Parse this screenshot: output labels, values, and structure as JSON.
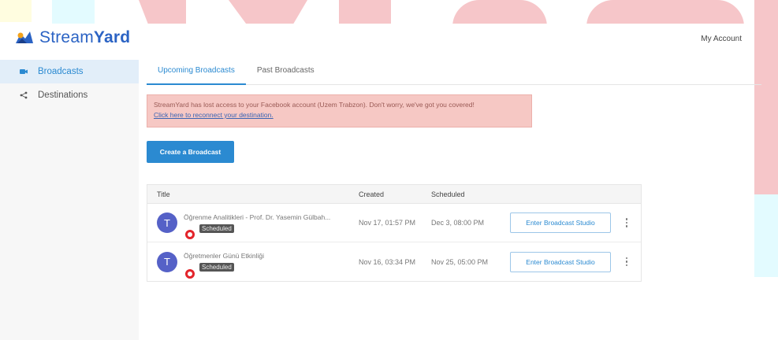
{
  "app": {
    "logo_text_light": "Stream",
    "logo_text_bold": "Yard",
    "account_label": "My Account"
  },
  "sidebar": {
    "items": [
      {
        "label": "Broadcasts",
        "icon": "camera-icon",
        "active": true
      },
      {
        "label": "Destinations",
        "icon": "share-icon",
        "active": false
      }
    ]
  },
  "tabs": [
    {
      "label": "Upcoming Broadcasts",
      "active": true
    },
    {
      "label": "Past Broadcasts",
      "active": false
    }
  ],
  "alert": {
    "message": "StreamYard has lost access to your Facebook account (Uzem Trabzon). Don't worry, we've got you covered!",
    "link": "Click here to reconnect your destination."
  },
  "create_button": "Create a Broadcast",
  "table": {
    "headers": {
      "title": "Title",
      "created": "Created",
      "scheduled": "Scheduled"
    },
    "rows": [
      {
        "avatar_letter": "T",
        "title": "Öğrenme Analitikleri - Prof. Dr. Yasemin Gülbah...",
        "status": "Scheduled",
        "created": "Nov 17, 01:57 PM",
        "scheduled": "Dec 3, 08:00 PM",
        "action": "Enter Broadcast Studio"
      },
      {
        "avatar_letter": "T",
        "title": "Öğretmenler Günü Etkinliği",
        "status": "Scheduled",
        "created": "Nov 16, 03:34 PM",
        "scheduled": "Nov 25, 05:00 PM",
        "action": "Enter Broadcast Studio"
      }
    ]
  },
  "colors": {
    "accent": "#2b8ad1",
    "brand": "#2b63c4",
    "alert_bg": "#f6c8c4",
    "avatar": "#5561c7",
    "youtube_red": "#e3242b"
  }
}
